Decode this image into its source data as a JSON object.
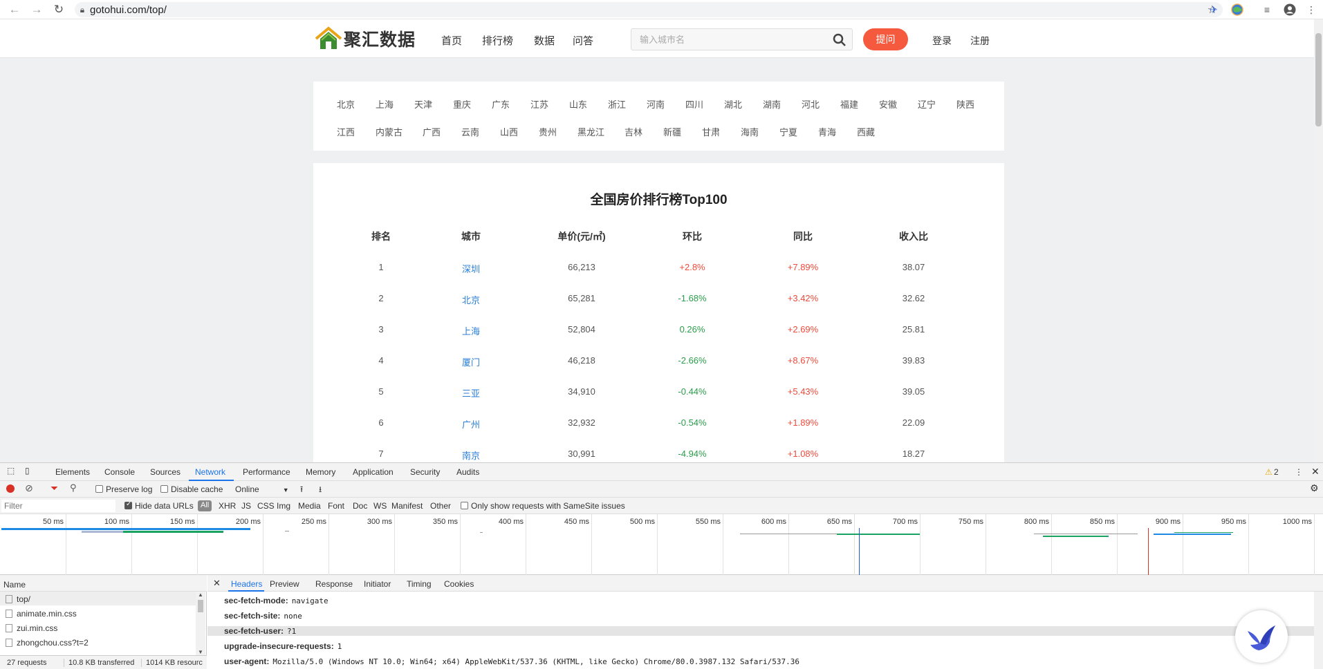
{
  "browser": {
    "url": "gotohui.com/top/",
    "icons": [
      "back-icon",
      "forward-icon",
      "reload-icon",
      "lock-icon",
      "star-icon",
      "extension-icon",
      "globe-extension-icon",
      "playlist-icon",
      "account-icon",
      "menu-icon"
    ]
  },
  "site": {
    "logo_text": "聚汇数据",
    "nav": [
      "首页",
      "排行榜",
      "数据",
      "问答"
    ],
    "search_placeholder": "输入城市名",
    "ask_label": "提问",
    "login_label": "登录",
    "register_label": "注册"
  },
  "cities": {
    "row1": [
      "北京",
      "上海",
      "天津",
      "重庆",
      "广东",
      "江苏",
      "山东",
      "浙江",
      "河南",
      "四川",
      "湖北",
      "湖南",
      "河北",
      "福建",
      "安徽",
      "辽宁",
      "陕西"
    ],
    "row2": [
      "江西",
      "内蒙古",
      "广西",
      "云南",
      "山西",
      "贵州",
      "黑龙江",
      "吉林",
      "新疆",
      "甘肃",
      "海南",
      "宁夏",
      "青海",
      "西藏"
    ]
  },
  "ranking": {
    "title": "全国房价排行榜Top100",
    "headers": [
      "排名",
      "城市",
      "单价(元/㎡)",
      "环比",
      "同比",
      "收入比"
    ],
    "rows": [
      {
        "rank": "1",
        "city": "深圳",
        "price": "66,213",
        "mom": "+2.8%",
        "yoy": "+7.89%",
        "ratio": "38.07"
      },
      {
        "rank": "2",
        "city": "北京",
        "price": "65,281",
        "mom": "-1.68%",
        "yoy": "+3.42%",
        "ratio": "32.62"
      },
      {
        "rank": "3",
        "city": "上海",
        "price": "52,804",
        "mom": "0.26%",
        "yoy": "+2.69%",
        "ratio": "25.81"
      },
      {
        "rank": "4",
        "city": "厦门",
        "price": "46,218",
        "mom": "-2.66%",
        "yoy": "+8.67%",
        "ratio": "39.83"
      },
      {
        "rank": "5",
        "city": "三亚",
        "price": "34,910",
        "mom": "-0.44%",
        "yoy": "+5.43%",
        "ratio": "39.05"
      },
      {
        "rank": "6",
        "city": "广州",
        "price": "32,932",
        "mom": "-0.54%",
        "yoy": "+1.89%",
        "ratio": "22.09"
      },
      {
        "rank": "7",
        "city": "南京",
        "price": "30,991",
        "mom": "-4.94%",
        "yoy": "+1.08%",
        "ratio": "18.27"
      }
    ]
  },
  "devtools": {
    "tabs": [
      "Elements",
      "Console",
      "Sources",
      "Network",
      "Performance",
      "Memory",
      "Application",
      "Security",
      "Audits"
    ],
    "active_tab": "Network",
    "warning_count": "2",
    "toolbar": {
      "preserve_log": "Preserve log",
      "disable_cache": "Disable cache",
      "throttle": "Online"
    },
    "filter": {
      "placeholder": "Filter",
      "hide_data_urls": "Hide data URLs",
      "types": [
        "All",
        "XHR",
        "JS",
        "CSS",
        "Img",
        "Media",
        "Font",
        "Doc",
        "WS",
        "Manifest",
        "Other"
      ],
      "samesite": "Only show requests with SameSite issues"
    },
    "timeline_ticks": [
      "50 ms",
      "100 ms",
      "150 ms",
      "200 ms",
      "250 ms",
      "300 ms",
      "350 ms",
      "400 ms",
      "450 ms",
      "500 ms",
      "550 ms",
      "600 ms",
      "650 ms",
      "700 ms",
      "750 ms",
      "800 ms",
      "850 ms",
      "900 ms",
      "950 ms",
      "1000 ms"
    ],
    "name_header": "Name",
    "requests": [
      "top/",
      "animate.min.css",
      "zui.min.css",
      "zhongchou.css?t=2"
    ],
    "status": {
      "requests": "27 requests",
      "transferred": "10.8 KB transferred",
      "resources": "1014 KB resourc"
    },
    "detail_tabs": [
      "Headers",
      "Preview",
      "Response",
      "Initiator",
      "Timing",
      "Cookies"
    ],
    "headers": [
      {
        "k": "sec-fetch-mode:",
        "v": "navigate"
      },
      {
        "k": "sec-fetch-site:",
        "v": "none"
      },
      {
        "k": "sec-fetch-user:",
        "v": "?1"
      },
      {
        "k": "upgrade-insecure-requests:",
        "v": "1"
      },
      {
        "k": "user-agent:",
        "v": "Mozilla/5.0 (Windows NT 10.0; Win64; x64) AppleWebKit/537.36 (KHTML, like Gecko) Chrome/80.0.3987.132 Safari/537.36"
      }
    ]
  },
  "colors": {
    "accent_red": "#f55a3f",
    "up": "#f04a3a",
    "down": "#2a9d4a",
    "link": "#2b7fd4",
    "devtools_blue": "#1a73e8"
  }
}
